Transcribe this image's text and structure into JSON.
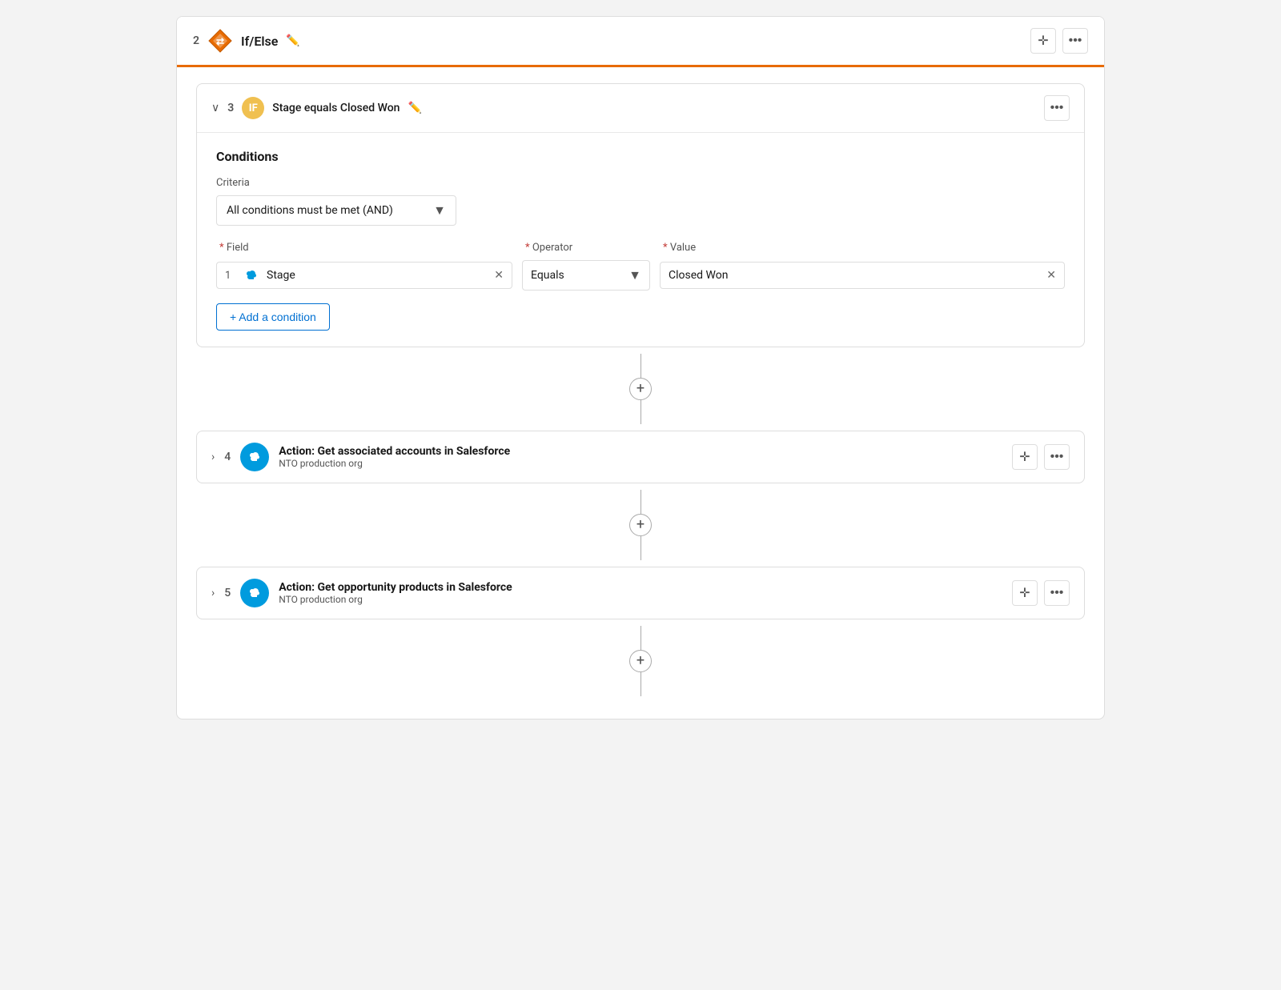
{
  "header": {
    "step_number": "2",
    "title": "If/Else",
    "move_icon": "⊕",
    "more_icon": "⋯"
  },
  "if_block": {
    "step_number": "3",
    "badge": "IF",
    "title": "Stage equals Closed Won",
    "more_icon": "⋯",
    "conditions_heading": "Conditions",
    "criteria_label": "Criteria",
    "criteria_value": "All conditions must be met (AND)",
    "field_header": "Field",
    "operator_header": "Operator",
    "value_header": "Value",
    "condition": {
      "num": "1",
      "field_name": "Stage",
      "operator": "Equals",
      "value": "Closed Won"
    },
    "add_condition_label": "+ Add a condition"
  },
  "actions": [
    {
      "step_number": "4",
      "title": "Action: Get associated accounts in Salesforce",
      "subtitle": "NTO production org"
    },
    {
      "step_number": "5",
      "title": "Action: Get opportunity products in Salesforce",
      "subtitle": "NTO production org"
    }
  ]
}
